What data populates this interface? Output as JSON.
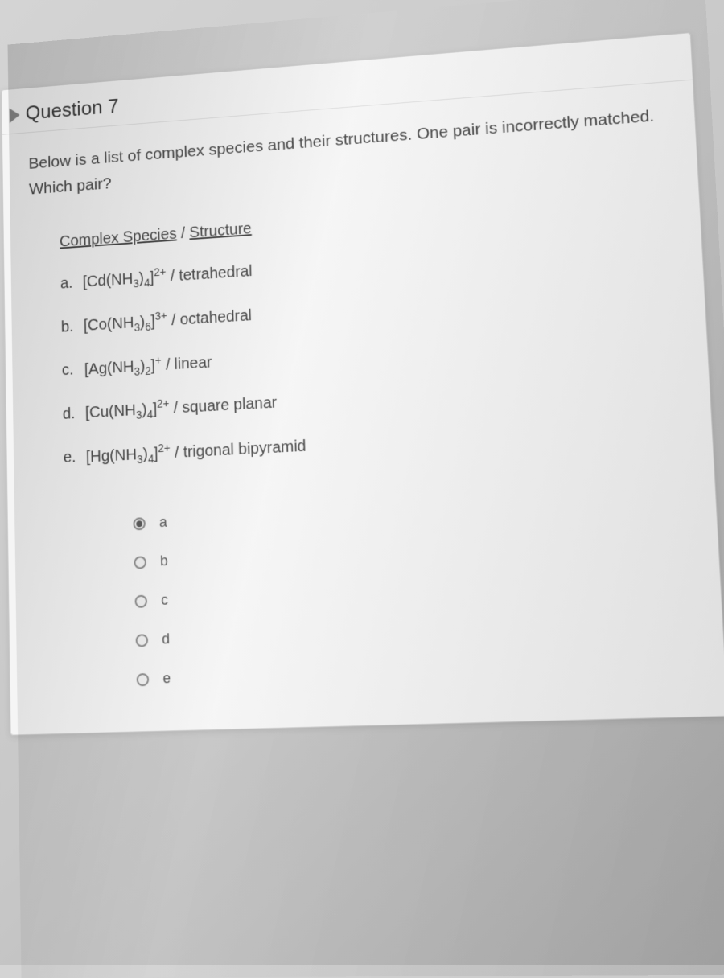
{
  "question": {
    "title": "Question 7",
    "prompt": "Below is a list of complex species and their structures. One pair is incorrectly matched. Which pair?",
    "tableHeader": {
      "col1": "Complex Species",
      "separator": " / ",
      "col2": "Structure"
    },
    "species": [
      {
        "label": "a.",
        "formula_pre": "[Cd(NH",
        "sub1": "3",
        "mid": ")",
        "sub2": "4",
        "post": "]",
        "charge": "2+",
        "structure": "tetrahedral"
      },
      {
        "label": "b.",
        "formula_pre": "[Co(NH",
        "sub1": "3",
        "mid": ")",
        "sub2": "6",
        "post": "]",
        "charge": "3+",
        "structure": "octahedral"
      },
      {
        "label": "c.",
        "formula_pre": "[Ag(NH",
        "sub1": "3",
        "mid": ")",
        "sub2": "2",
        "post": "]",
        "charge": "+",
        "structure": "linear"
      },
      {
        "label": "d.",
        "formula_pre": "[Cu(NH",
        "sub1": "3",
        "mid": ")",
        "sub2": "4",
        "post": "]",
        "charge": "2+",
        "structure": "square planar"
      },
      {
        "label": "e.",
        "formula_pre": "[Hg(NH",
        "sub1": "3",
        "mid": ")",
        "sub2": "4",
        "post": "]",
        "charge": "2+",
        "structure": "trigonal bipyramid"
      }
    ],
    "options": [
      {
        "label": "a",
        "selected": true
      },
      {
        "label": "b",
        "selected": false
      },
      {
        "label": "c",
        "selected": false
      },
      {
        "label": "d",
        "selected": false
      },
      {
        "label": "e",
        "selected": false
      }
    ]
  }
}
